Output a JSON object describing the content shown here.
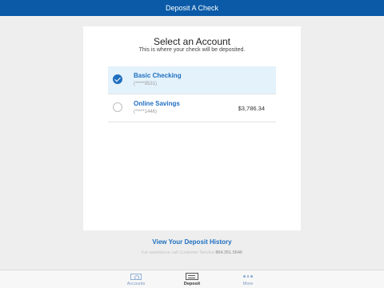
{
  "header": {
    "title": "Deposit A Check"
  },
  "card": {
    "title": "Select an Account",
    "subtitle": "This is where your check will be deposited.",
    "accounts": [
      {
        "name": "Basic Checking",
        "number": "(*****9531)",
        "balance": "",
        "selected": true
      },
      {
        "name": "Online Savings",
        "number": "(*****1446)",
        "balance": "$3,786.34",
        "selected": false
      }
    ]
  },
  "footer": {
    "history_link": "View Your Deposit History",
    "assist_text": "For assistance call Customer Service",
    "assist_phone": "864.351.5646"
  },
  "tabbar": {
    "tabs": [
      {
        "label": "Accounts",
        "icon": "accounts-icon",
        "active": false
      },
      {
        "label": "Deposit",
        "icon": "deposit-check-icon",
        "active": true
      },
      {
        "label": "More",
        "icon": "more-dots-icon",
        "active": false
      }
    ]
  },
  "colors": {
    "header": "#0a5aa8",
    "accent": "#1f6fc0",
    "selected_row": "#e4f2fb"
  }
}
